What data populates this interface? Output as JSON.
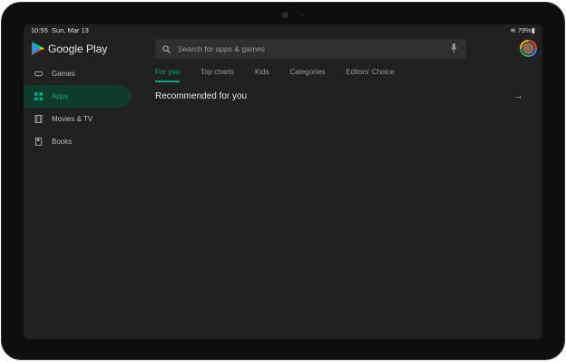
{
  "status": {
    "time": "10:55",
    "date": "Sun, Mar 13",
    "battery": "79%"
  },
  "app": {
    "name": "Google Play"
  },
  "sidebar": {
    "items": [
      {
        "label": "Games",
        "icon": "gamepad-icon"
      },
      {
        "label": "Apps",
        "icon": "apps-grid-icon",
        "active": true
      },
      {
        "label": "Movies & TV",
        "icon": "film-icon"
      },
      {
        "label": "Books",
        "icon": "book-icon"
      }
    ]
  },
  "search": {
    "placeholder": "Search for apps & games"
  },
  "tabs": [
    {
      "label": "For you",
      "active": true
    },
    {
      "label": "Top charts"
    },
    {
      "label": "Kids"
    },
    {
      "label": "Categories"
    },
    {
      "label": "Editors' Choice"
    }
  ],
  "section": {
    "title": "Recommended for you"
  },
  "colors": {
    "accent": "#01a884",
    "background": "#202020"
  }
}
